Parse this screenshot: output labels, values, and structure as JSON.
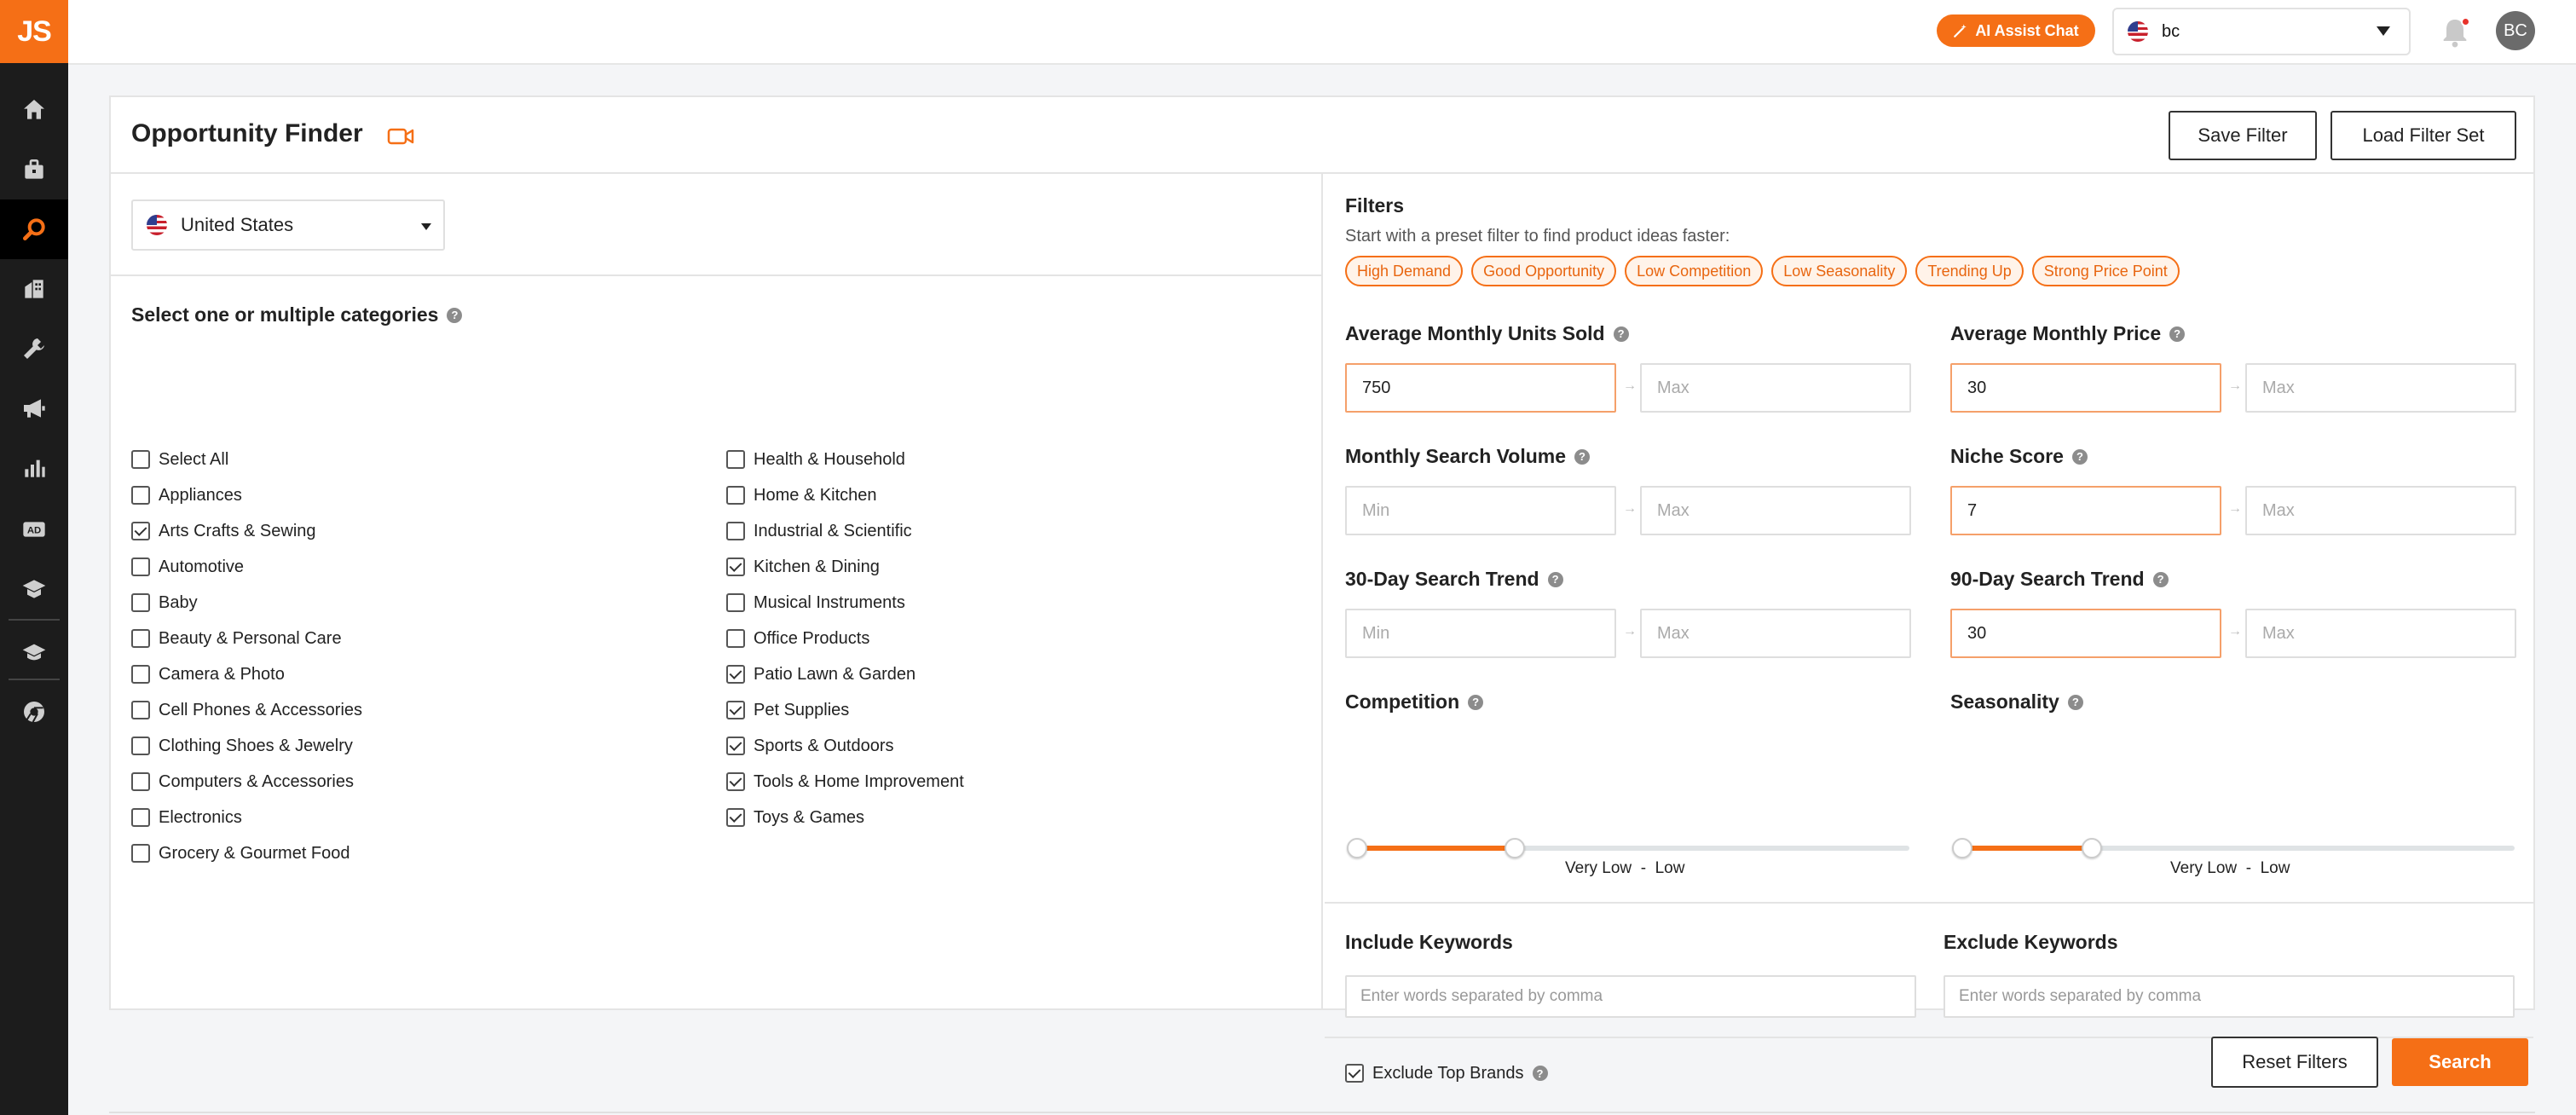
{
  "app": {
    "logo_text": "JS",
    "accent": "#f56f16"
  },
  "sidebar": {
    "items": [
      {
        "icon": "home-icon",
        "active": false
      },
      {
        "icon": "briefcase-icon",
        "active": false
      },
      {
        "icon": "search-opportunity-icon",
        "active": true
      },
      {
        "icon": "building-icon",
        "active": false
      },
      {
        "icon": "tools-icon",
        "active": false
      },
      {
        "icon": "megaphone-icon",
        "active": false
      },
      {
        "icon": "bar-chart-icon",
        "active": false
      },
      {
        "icon": "ad-icon",
        "active": false
      },
      {
        "icon": "graduation-icon",
        "active": false
      },
      {
        "icon": "academy-icon",
        "active": false
      },
      {
        "icon": "chrome-extension-icon",
        "active": false
      }
    ],
    "ad_label": "AD"
  },
  "topbar": {
    "ai_button": "AI Assist Chat",
    "account": "bc",
    "avatar_initials": "BC"
  },
  "page": {
    "title": "Opportunity Finder",
    "save_filter": "Save Filter",
    "load_filter_set": "Load Filter Set"
  },
  "left": {
    "country": "United States",
    "categories_title": "Select one or multiple categories",
    "categories_col1": [
      {
        "label": "Select All",
        "checked": false
      },
      {
        "label": "Appliances",
        "checked": false
      },
      {
        "label": "Arts Crafts & Sewing",
        "checked": true
      },
      {
        "label": "Automotive",
        "checked": false
      },
      {
        "label": "Baby",
        "checked": false
      },
      {
        "label": "Beauty & Personal Care",
        "checked": false
      },
      {
        "label": "Camera & Photo",
        "checked": false
      },
      {
        "label": "Cell Phones & Accessories",
        "checked": false
      },
      {
        "label": "Clothing Shoes & Jewelry",
        "checked": false
      },
      {
        "label": "Computers & Accessories",
        "checked": false
      },
      {
        "label": "Electronics",
        "checked": false
      },
      {
        "label": "Grocery & Gourmet Food",
        "checked": false
      }
    ],
    "categories_col2": [
      {
        "label": "Health & Household",
        "checked": false
      },
      {
        "label": "Home & Kitchen",
        "checked": false
      },
      {
        "label": "Industrial & Scientific",
        "checked": false
      },
      {
        "label": "Kitchen & Dining",
        "checked": true
      },
      {
        "label": "Musical Instruments",
        "checked": false
      },
      {
        "label": "Office Products",
        "checked": false
      },
      {
        "label": "Patio Lawn & Garden",
        "checked": true
      },
      {
        "label": "Pet Supplies",
        "checked": true
      },
      {
        "label": "Sports & Outdoors",
        "checked": true
      },
      {
        "label": "Tools & Home Improvement",
        "checked": true
      },
      {
        "label": "Toys & Games",
        "checked": true
      }
    ]
  },
  "filters": {
    "title": "Filters",
    "subtitle": "Start with a preset filter to find product ideas faster:",
    "presets": [
      "High Demand",
      "Good Opportunity",
      "Low Competition",
      "Low Seasonality",
      "Trending Up",
      "Strong Price Point"
    ],
    "units_sold": {
      "label": "Average Monthly Units Sold",
      "min": "750",
      "max_placeholder": "Max"
    },
    "monthly_price": {
      "label": "Average Monthly Price",
      "min": "30",
      "max_placeholder": "Max"
    },
    "search_volume": {
      "label": "Monthly Search Volume",
      "min_placeholder": "Min",
      "max_placeholder": "Max"
    },
    "niche_score": {
      "label": "Niche Score",
      "min": "7",
      "max_placeholder": "Max"
    },
    "trend_30": {
      "label": "30-Day Search Trend",
      "min_placeholder": "Min",
      "max_placeholder": "Max"
    },
    "trend_90": {
      "label": "90-Day Search Trend",
      "min": "30",
      "max_placeholder": "Max"
    },
    "competition": {
      "label": "Competition",
      "value_text": "Very Low  -  Low",
      "fill_fraction": 0.29
    },
    "seasonality": {
      "label": "Seasonality",
      "value_text": "Very Low  -  Low",
      "fill_fraction": 0.24
    },
    "include_keywords": {
      "label": "Include Keywords",
      "placeholder": "Enter words separated by comma"
    },
    "exclude_keywords": {
      "label": "Exclude Keywords",
      "placeholder": "Enter words separated by comma"
    },
    "exclude_top_brands": {
      "label": "Exclude Top Brands",
      "checked": true
    }
  },
  "actions": {
    "reset": "Reset Filters",
    "search": "Search"
  }
}
